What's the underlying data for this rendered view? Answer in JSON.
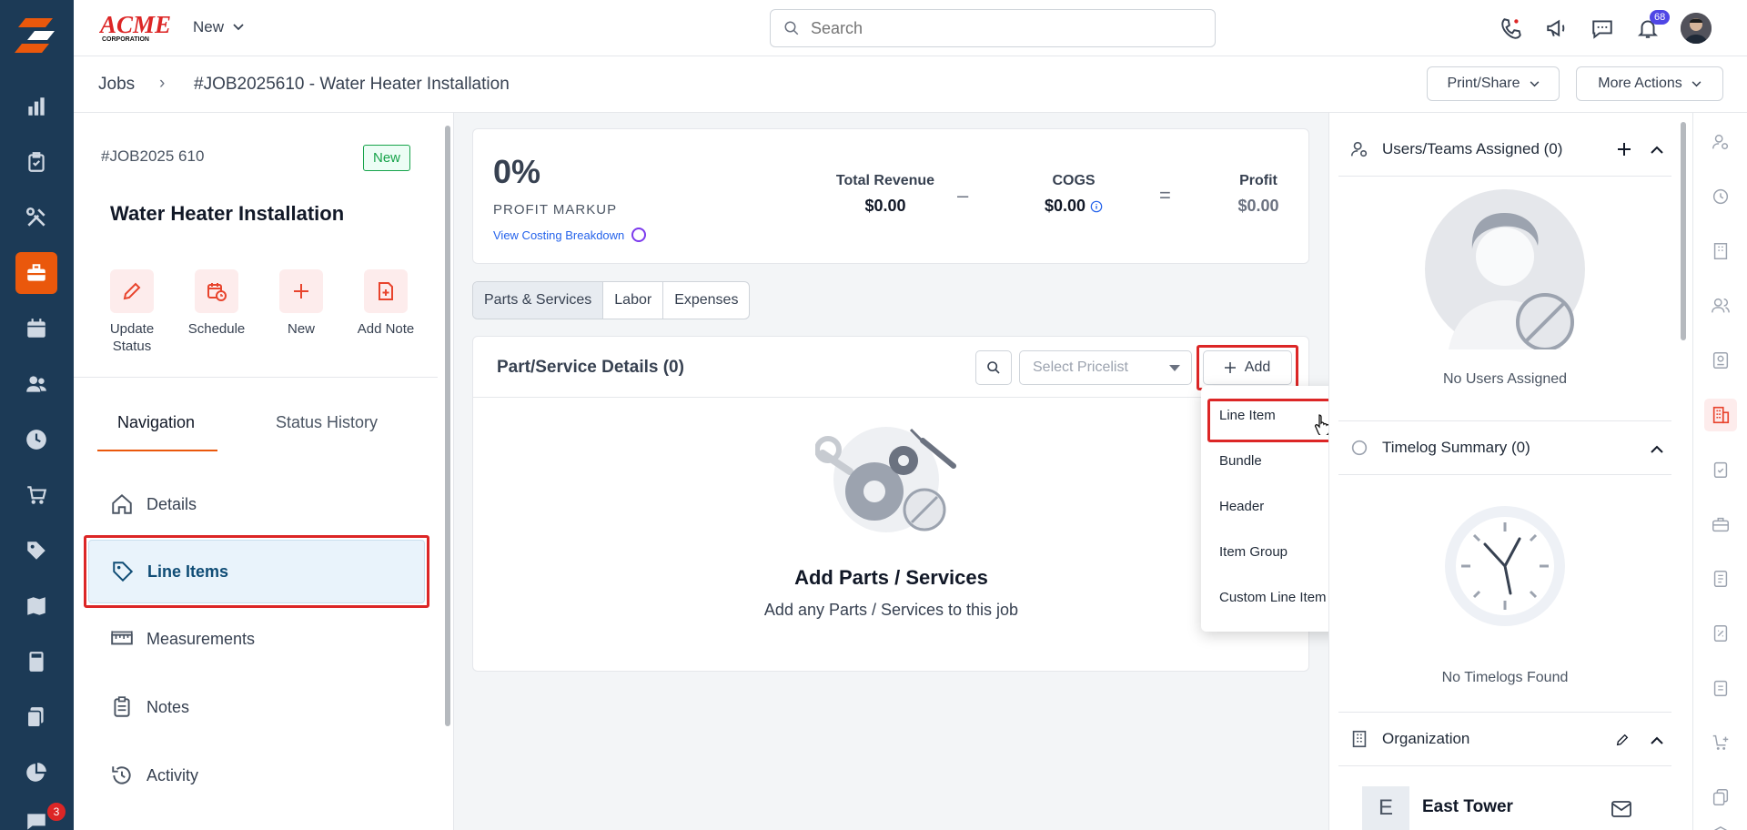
{
  "rail": {
    "icons": [
      "dashboard-icon",
      "clipboard-icon",
      "tools-icon",
      "briefcase-icon",
      "calendar-icon",
      "users-icon",
      "clock-icon",
      "cart-icon",
      "tag-icon",
      "map-icon",
      "calculator-icon",
      "documents-icon",
      "pie-chart-icon",
      "chat-icon"
    ],
    "active": "briefcase-icon",
    "chat_badge": "3",
    "accent": "#ea580c",
    "bg": "#1c3a56"
  },
  "header": {
    "brand": "ACME",
    "brand_sub": "CORPORATION",
    "new_label": "New",
    "search_placeholder": "Search",
    "notification_count": "68"
  },
  "breadcrumb": {
    "root": "Jobs",
    "separator": "›",
    "title": "#JOB2025610 - Water Heater Installation",
    "print_share": "Print/Share",
    "more_actions": "More Actions"
  },
  "job": {
    "number": "#JOB2025 610",
    "status": "New",
    "title": "Water Heater Installation"
  },
  "quick_actions": [
    {
      "label": "Update\nStatus",
      "icon": "pencil-icon"
    },
    {
      "label": "Schedule",
      "icon": "calendar-clock-icon"
    },
    {
      "label": "New",
      "icon": "plus-icon"
    },
    {
      "label": "Add Note",
      "icon": "note-add-icon"
    }
  ],
  "nav_tabs": {
    "navigation": "Navigation",
    "status_history": "Status History"
  },
  "nav_items": [
    {
      "label": "Details",
      "icon": "home-icon"
    },
    {
      "label": "Line Items",
      "icon": "tag-icon"
    },
    {
      "label": "Measurements",
      "icon": "ruler-icon"
    },
    {
      "label": "Notes",
      "icon": "clipboard-icon"
    },
    {
      "label": "Activity",
      "icon": "history-icon"
    }
  ],
  "profit": {
    "percent": "0%",
    "markup_label": "PROFIT MARKUP",
    "costing_link": "View Costing Breakdown",
    "total_revenue_label": "Total Revenue",
    "total_revenue": "$0.00",
    "minus": "–",
    "cogs_label": "COGS",
    "cogs": "$0.00",
    "equals": "=",
    "profit_label": "Profit",
    "profit": "$0.00"
  },
  "segments": [
    "Parts & Services",
    "Labor",
    "Expenses"
  ],
  "parts": {
    "title": "Part/Service Details (0)",
    "pricelist_placeholder": "Select Pricelist",
    "add_label": "Add",
    "empty_title": "Add Parts / Services",
    "empty_sub": "Add any Parts / Services to this job"
  },
  "add_menu": [
    "Line Item",
    "Bundle",
    "Header",
    "Item Group",
    "Custom Line Item"
  ],
  "right": {
    "users_title": "Users/Teams Assigned (0)",
    "no_users": "No Users Assigned",
    "timelog_title": "Timelog Summary (0)",
    "no_timelogs": "No Timelogs Found",
    "org_title": "Organization",
    "org_initial": "E",
    "org_name": "East Tower"
  },
  "highlight_color": "#dc2626"
}
